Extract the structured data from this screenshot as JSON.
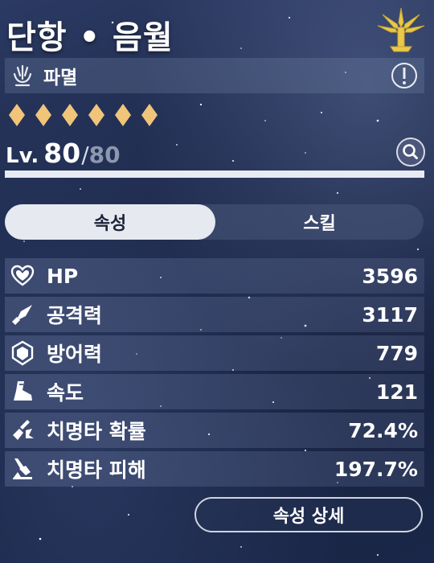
{
  "character": {
    "name": "단항 • 음월",
    "path": "파멸"
  },
  "rarity": {
    "stars": 6,
    "color": "#f0c57a"
  },
  "level": {
    "prefix": "Lv.",
    "current": "80",
    "separator": "/",
    "max": "80",
    "progress": 1.0
  },
  "tabs": [
    {
      "label": "속성",
      "active": true
    },
    {
      "label": "스킬",
      "active": false
    }
  ],
  "stats": [
    {
      "icon": "heart-icon",
      "label": "HP",
      "value": "3596"
    },
    {
      "icon": "sword-icon",
      "label": "공격력",
      "value": "3117"
    },
    {
      "icon": "shield-icon",
      "label": "방어력",
      "value": "779"
    },
    {
      "icon": "boot-icon",
      "label": "속도",
      "value": "121"
    },
    {
      "icon": "crit-rate-icon",
      "label": "치명타 확률",
      "value": "72.4%"
    },
    {
      "icon": "crit-damage-icon",
      "label": "치명타 피해",
      "value": "197.7%"
    }
  ],
  "detail_button": {
    "label": "속성 상세"
  },
  "colors": {
    "accent_gold": "#f0c57a",
    "emblem_gold": "#e8c94a",
    "tab_active_bg": "#e6e9f0"
  }
}
